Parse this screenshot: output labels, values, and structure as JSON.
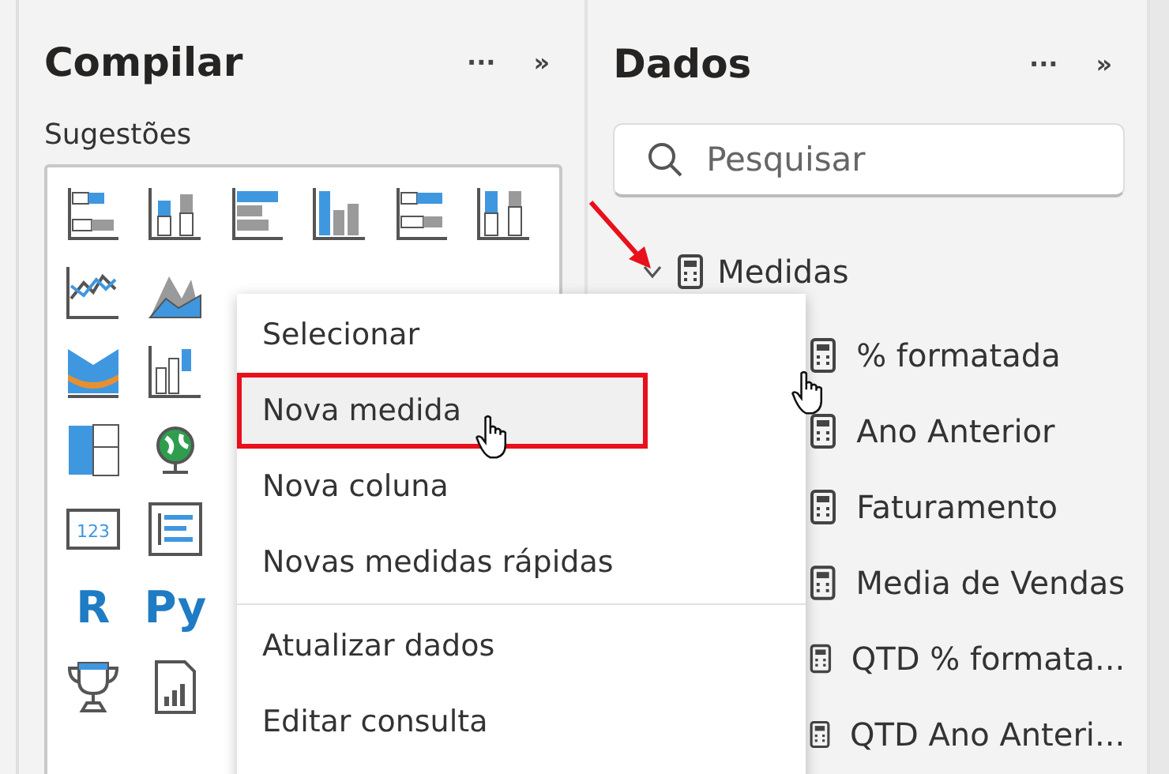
{
  "build_pane": {
    "title": "Compilar",
    "more": "···",
    "collapse": "»",
    "section": "Sugestões",
    "visuals": [
      {
        "kind": "stacked-bar"
      },
      {
        "kind": "stacked-column"
      },
      {
        "kind": "clustered-bar"
      },
      {
        "kind": "clustered-column"
      },
      {
        "kind": "bar-100"
      },
      {
        "kind": "column-100"
      },
      {
        "kind": "line"
      },
      {
        "kind": "area"
      },
      {
        "kind": "ribbon"
      },
      {
        "kind": "waterfall"
      },
      {
        "kind": "treemap"
      },
      {
        "kind": "globe"
      },
      {
        "kind": "card",
        "label": "123"
      },
      {
        "kind": "multirow"
      },
      {
        "kind": "text",
        "label": "R"
      },
      {
        "kind": "text",
        "label": "Py"
      },
      {
        "kind": "trophy"
      },
      {
        "kind": "report"
      }
    ]
  },
  "data_pane": {
    "title": "Dados",
    "more": "···",
    "collapse": "»",
    "search": {
      "placeholder": "Pesquisar"
    },
    "tables": [
      {
        "name": "Medidas",
        "expanded": true,
        "children": [
          "% formatada",
          "Ano Anterior",
          "Faturamento",
          "Media de Vendas",
          "QTD % formata...",
          "QTD Ano Anteri..."
        ]
      }
    ]
  },
  "context_menu": {
    "groups": [
      [
        {
          "label": "Selecionar",
          "selected": false
        },
        {
          "label": "Nova medida",
          "selected": true
        },
        {
          "label": "Nova coluna",
          "selected": false
        },
        {
          "label": "Novas medidas rápidas",
          "selected": false
        }
      ],
      [
        {
          "label": "Atualizar dados",
          "selected": false
        },
        {
          "label": "Editar consulta",
          "selected": false
        }
      ]
    ]
  }
}
